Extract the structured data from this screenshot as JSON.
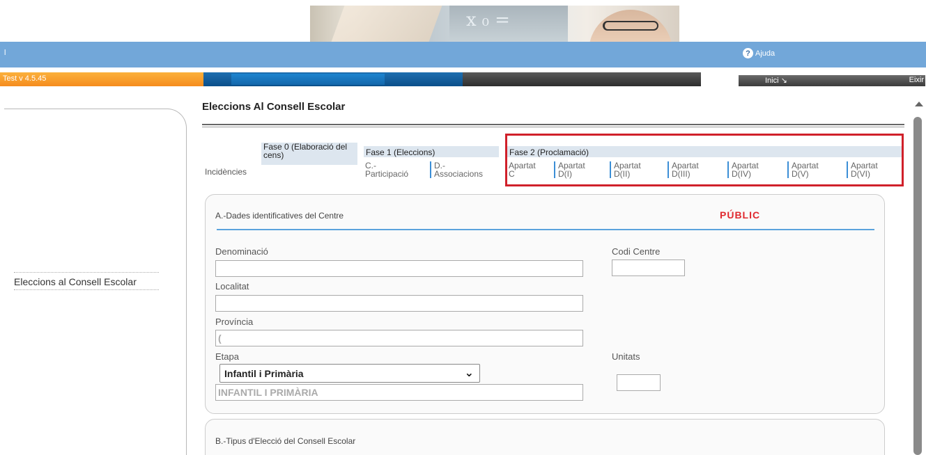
{
  "header": {
    "pipe": "l",
    "help_label": "Ajuda",
    "version": "Test v 4.5.45",
    "inici_label": "Inici ↘",
    "eixir_label": "Eixir"
  },
  "sidebar": {
    "items": [
      {
        "label": "Eleccions al Consell Escolar"
      }
    ]
  },
  "main": {
    "title": "Eleccions Al Consell Escolar",
    "tabs": {
      "incidencies": "Incidències",
      "phase0": "Fase 0 (Elaboració del cens)",
      "phase1": "Fase 1 (Eleccions)",
      "phase1_sub": [
        "C.- Participació",
        "D.- Associacions"
      ],
      "phase2": "Fase 2 (Proclamació)",
      "phase2_sub": [
        "Apartat C",
        "Apartat D(I)",
        "Apartat D(II)",
        "Apartat D(III)",
        "Apartat D(IV)",
        "Apartat D(V)",
        "Apartat D(VI)"
      ]
    },
    "section_a": {
      "title": "A.-Dades identificatives del Centre",
      "badge": "PÚBLIC",
      "fields": {
        "denominacio": {
          "label": "Denominació",
          "value": ""
        },
        "codi_centre": {
          "label": "Codi Centre",
          "value": ""
        },
        "localitat": {
          "label": "Localitat",
          "value": ""
        },
        "provincia": {
          "label": "Província",
          "value": "("
        },
        "etapa": {
          "label": "Etapa",
          "selected": "Infantil i Primària",
          "readonly_value": "INFANTIL I PRIMÀRIA"
        },
        "unitats": {
          "label": "Unitats",
          "value": ""
        }
      }
    },
    "section_b": {
      "title": "B.-Tipus d'Elecció del Consell Escolar"
    }
  },
  "colors": {
    "accent_blue": "#72a7d9",
    "orange": "#f58c1e",
    "red_highlight": "#d0202a",
    "public_red": "#e0292f"
  }
}
